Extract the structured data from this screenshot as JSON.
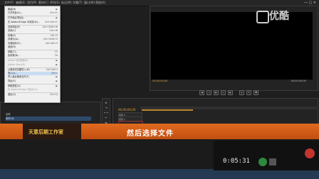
{
  "menubar": {
    "items": [
      "文件(F)",
      "编辑(E)",
      "项目(P)",
      "素材(C)",
      "序列(S)",
      "标记(M)",
      "字幕(T)",
      "窗口(W)",
      "帮助(H)"
    ]
  },
  "file_menu": {
    "items": [
      {
        "label": "新建(N)",
        "shortcut": "▶"
      },
      {
        "label": "打开项目(O)...",
        "shortcut": "Ctrl+O"
      },
      {
        "label": "打开最近项目(J)",
        "shortcut": "▶"
      },
      {
        "label": "在 Adobe Bridge 中浏览(W)...",
        "shortcut": "Ctrl+Alt+O"
      },
      {
        "label": "关闭项目(P)",
        "shortcut": "Ctrl+Shift+W"
      },
      {
        "label": "关闭(C)",
        "shortcut": "Ctrl+W"
      },
      {
        "label": "存储(S)",
        "shortcut": "Ctrl+S"
      },
      {
        "label": "存储为(A)...",
        "shortcut": "Ctrl+Shift+S"
      },
      {
        "label": "存储副本(Y)...",
        "shortcut": "Ctrl+Alt+S"
      },
      {
        "label": "返回(R)",
        "shortcut": ""
      },
      {
        "label": "采集(T)...",
        "shortcut": "F5"
      },
      {
        "label": "批采集(B)...",
        "shortcut": "F6"
      },
      {
        "label": "Adobe 动态链接(K)",
        "shortcut": "▶"
      },
      {
        "label": "Adobe Story(R)",
        "shortcut": "▶"
      },
      {
        "label": "从媒体浏览器导入(M)",
        "shortcut": "Ctrl+Alt+I"
      },
      {
        "label": "导入(I)...",
        "shortcut": "Ctrl+I"
      },
      {
        "label": "导入最近使用文件(F)",
        "shortcut": "▶"
      },
      {
        "label": "导出(E)",
        "shortcut": "▶"
      },
      {
        "label": "获取属性(G)",
        "shortcut": "▶"
      },
      {
        "label": "在 Adobe Bridge 中显示(V)...",
        "shortcut": ""
      },
      {
        "label": "退出(X)",
        "shortcut": "Ctrl+Q"
      }
    ]
  },
  "project": {
    "rows": [
      "名称",
      "序列 01"
    ]
  },
  "program_monitor": {
    "timecode_left": "00;00;00;00",
    "timecode_right": "00;00;00;00"
  },
  "timeline": {
    "timecode": "00;00;00;00",
    "tracks": [
      "视频 3",
      "视频 2",
      "视频 1",
      "音频 1",
      "音频 2",
      "音频 3"
    ]
  },
  "banner": {
    "logo_text": "天意后期工作室",
    "subtitle": "然后选择文件"
  },
  "player": {
    "time": "0:05:31"
  },
  "watermark": {
    "text": "优酷"
  },
  "colors": {
    "banner": "#e06a1f",
    "timecode": "#e3a53c"
  }
}
